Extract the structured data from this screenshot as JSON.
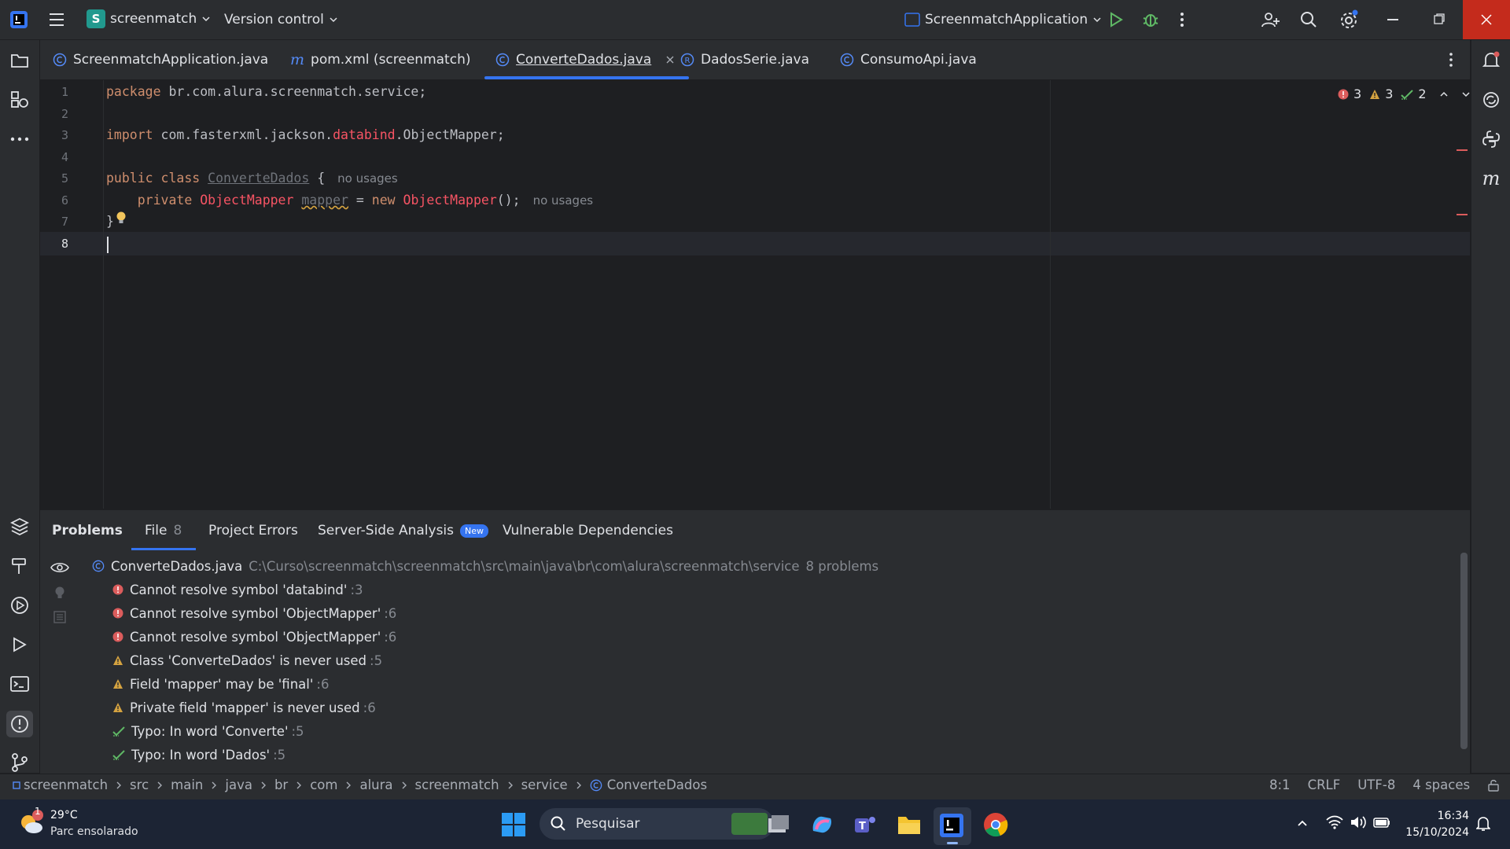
{
  "titlebar": {
    "project_badge": "S",
    "project_name": "screenmatch",
    "vcs": "Version control",
    "run_config": "ScreenmatchApplication"
  },
  "tabs": [
    {
      "label": "ScreenmatchApplication.java",
      "icon": "class-icon"
    },
    {
      "label": "pom.xml (screenmatch)",
      "icon": "maven-icon"
    },
    {
      "label": "ConverteDados.java",
      "icon": "class-icon",
      "active": true
    },
    {
      "label": "DadosSerie.java",
      "icon": "record-icon"
    },
    {
      "label": "ConsumoApi.java",
      "icon": "class-icon"
    }
  ],
  "editor": {
    "inspection": {
      "errors": "3",
      "warnings": "3",
      "typos": "2"
    },
    "line_numbers": [
      "1",
      "2",
      "3",
      "4",
      "5",
      "6",
      "7",
      "8"
    ],
    "lines": {
      "l1_kw": "package",
      "l1_rest": " br.com.alura.screenmatch.service;",
      "l3_kw": "import",
      "l3_a": " com.fasterxml.jackson.",
      "l3_err": "databind",
      "l3_b": ".ObjectMapper;",
      "l5_kw": "public class",
      "l5_name": "ConverteDados",
      "l5_brace": " {",
      "l5_hint": "no usages",
      "l6_kw": "    private",
      "l6_type": "ObjectMapper",
      "l6_field": "mapper",
      "l6_eq": " = ",
      "l6_new": "new",
      "l6_type2": "ObjectMapper",
      "l6_end": "();",
      "l6_hint": "no usages",
      "l7": "}"
    }
  },
  "problems": {
    "tabs": {
      "problems": "Problems",
      "file": "File",
      "file_count": "8",
      "project_errors": "Project Errors",
      "server_side": "Server-Side Analysis",
      "new_badge": "New",
      "vulnerable": "Vulnerable Dependencies"
    },
    "file_header": {
      "name": "ConverteDados.java",
      "path": "C:\\Curso\\screenmatch\\screenmatch\\src\\main\\java\\br\\com\\alura\\screenmatch\\service",
      "count": "8 problems"
    },
    "items": [
      {
        "type": "error",
        "text": "Cannot resolve symbol 'databind'",
        "line": ":3"
      },
      {
        "type": "error",
        "text": "Cannot resolve symbol 'ObjectMapper'",
        "line": ":6"
      },
      {
        "type": "error",
        "text": "Cannot resolve symbol 'ObjectMapper'",
        "line": ":6"
      },
      {
        "type": "warning",
        "text": "Class 'ConverteDados' is never used",
        "line": ":5"
      },
      {
        "type": "warning",
        "text": "Field 'mapper' may be 'final'",
        "line": ":6"
      },
      {
        "type": "warning",
        "text": "Private field 'mapper' is never used",
        "line": ":6"
      },
      {
        "type": "typo",
        "text": "Typo: In word 'Converte'",
        "line": ":5"
      },
      {
        "type": "typo",
        "text": "Typo: In word 'Dados'",
        "line": ":5"
      }
    ]
  },
  "statusbar": {
    "breadcrumb": [
      "screenmatch",
      "src",
      "main",
      "java",
      "br",
      "com",
      "alura",
      "screenmatch",
      "service",
      "ConverteDados"
    ],
    "position": "8:1",
    "line_sep": "CRLF",
    "encoding": "UTF-8",
    "indent": "4 spaces"
  },
  "taskbar": {
    "weather_temp": "29°C",
    "weather_desc": "Parc ensolarado",
    "weather_badge": "1",
    "search_placeholder": "Pesquisar",
    "time": "16:34",
    "date": "15/10/2024"
  },
  "colors": {
    "accent": "#3574f0",
    "error": "#db5c5c",
    "warning": "#d5a340",
    "typo": "#5fb865",
    "close": "#c42b1c"
  }
}
